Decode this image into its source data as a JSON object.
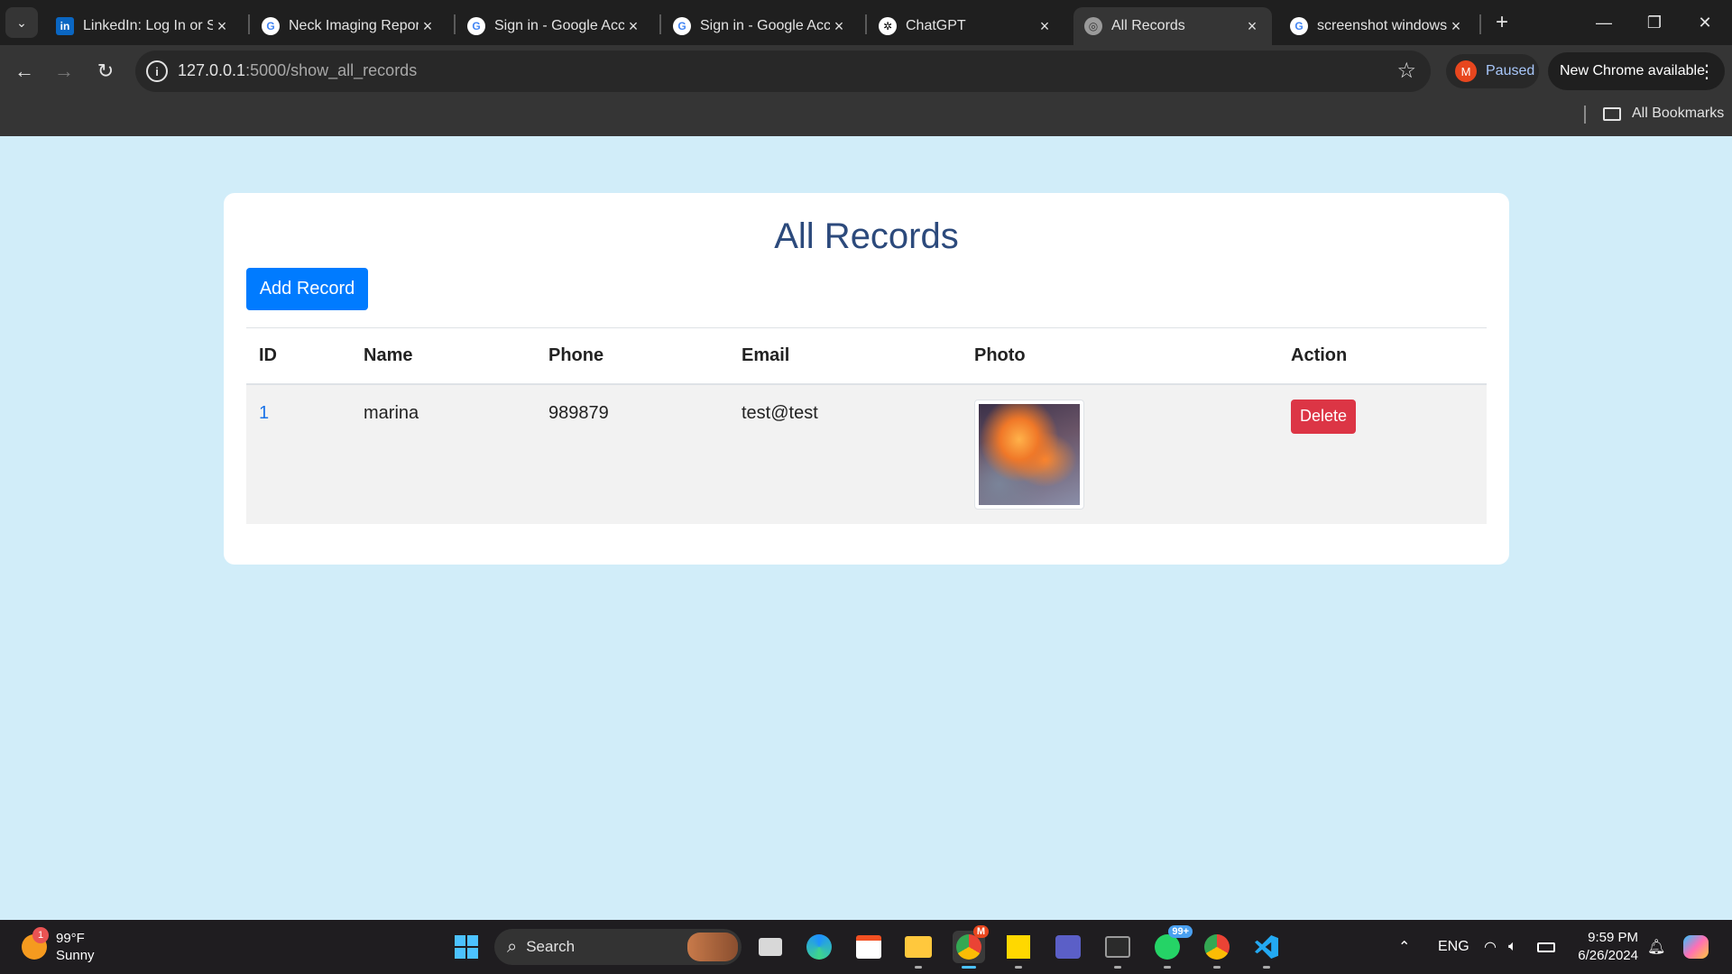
{
  "browser": {
    "tabs": [
      {
        "title": "LinkedIn: Log In or Sign Up",
        "favicon": "linkedin-icon",
        "active": false
      },
      {
        "title": "Neck Imaging Report",
        "favicon": "google-icon",
        "active": false
      },
      {
        "title": "Sign in - Google Accounts",
        "favicon": "google-icon",
        "active": false
      },
      {
        "title": "Sign in - Google Accounts",
        "favicon": "google-icon",
        "active": false
      },
      {
        "title": "ChatGPT",
        "favicon": "chatgpt-icon",
        "active": false
      },
      {
        "title": "All Records",
        "favicon": "globe-icon",
        "active": true
      },
      {
        "title": "screenshot windows",
        "favicon": "google-icon",
        "active": false
      }
    ],
    "url_host": "127.0.0.1",
    "url_path": ":5000/show_all_records",
    "profile_initial": "M",
    "profile_status": "Paused",
    "update_label": "New Chrome available",
    "bookmarks_label": "All Bookmarks"
  },
  "page": {
    "title": "All Records",
    "add_button": "Add Record",
    "columns": [
      "ID",
      "Name",
      "Phone",
      "Email",
      "Photo",
      "Action"
    ],
    "rows": [
      {
        "id": "1",
        "name": "marina",
        "phone": "989879",
        "email": "test@test",
        "action": "Delete"
      }
    ]
  },
  "taskbar": {
    "weather_temp": "99°F",
    "weather_desc": "Sunny",
    "weather_badge": "1",
    "search_label": "Search",
    "whatsapp_badge": "99+",
    "chrome_badge": "M",
    "lang": "ENG",
    "time": "9:59 PM",
    "date": "6/26/2024"
  },
  "colors": {
    "page_background": "#d1edf9",
    "title": "#2c4a7c",
    "primary_button": "#007bff",
    "danger_button": "#dc3545",
    "browser_chrome": "#1f1f1f"
  }
}
